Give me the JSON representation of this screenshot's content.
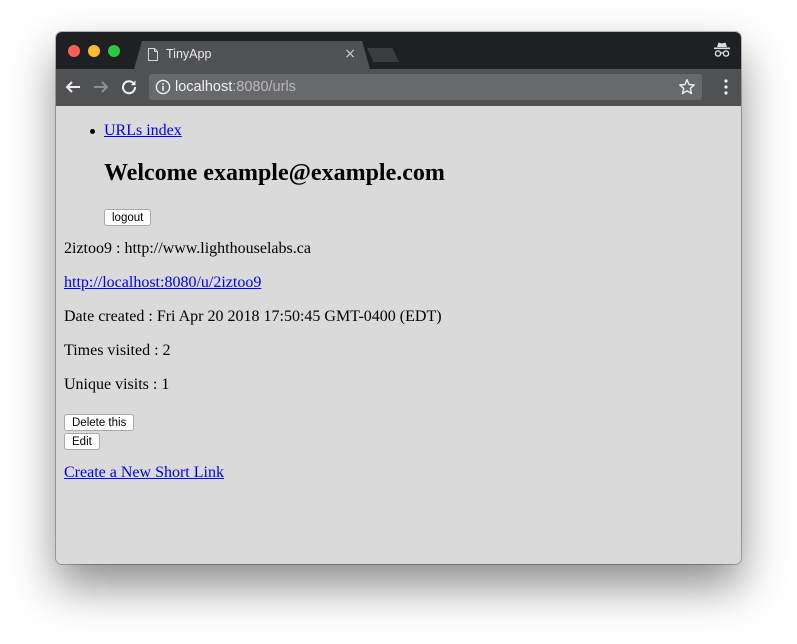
{
  "browser": {
    "tab_title": "TinyApp",
    "tab_close": "×",
    "url_host": "localhost",
    "url_rest": ":8080/urls"
  },
  "page": {
    "nav": {
      "urls_index_label": "URLs index"
    },
    "welcome": "Welcome example@example.com",
    "logout_label": "logout",
    "short_url_line": "2iztoo9 : http://www.lighthouselabs.ca",
    "short_link": "http://localhost:8080/u/2iztoo9",
    "date_created": "Date created : Fri Apr 20 2018 17:50:45 GMT-0400 (EDT)",
    "times_visited": "Times visited : 2",
    "unique_visits": "Unique visits : 1",
    "delete_label": "Delete this",
    "edit_label": "Edit",
    "create_link_label": "Create a New Short Link"
  },
  "icons": {
    "tab_favicon": "page-icon",
    "incognito": "incognito-icon",
    "back": "arrow-left-icon",
    "forward": "arrow-right-icon",
    "reload": "reload-icon",
    "info": "info-icon",
    "star": "star-icon",
    "menu": "kebab-menu-icon"
  },
  "colors": {
    "link": "#0000ee",
    "page_background": "#dadada",
    "titlebar": "#1f2023",
    "toolbar": "#505153"
  }
}
